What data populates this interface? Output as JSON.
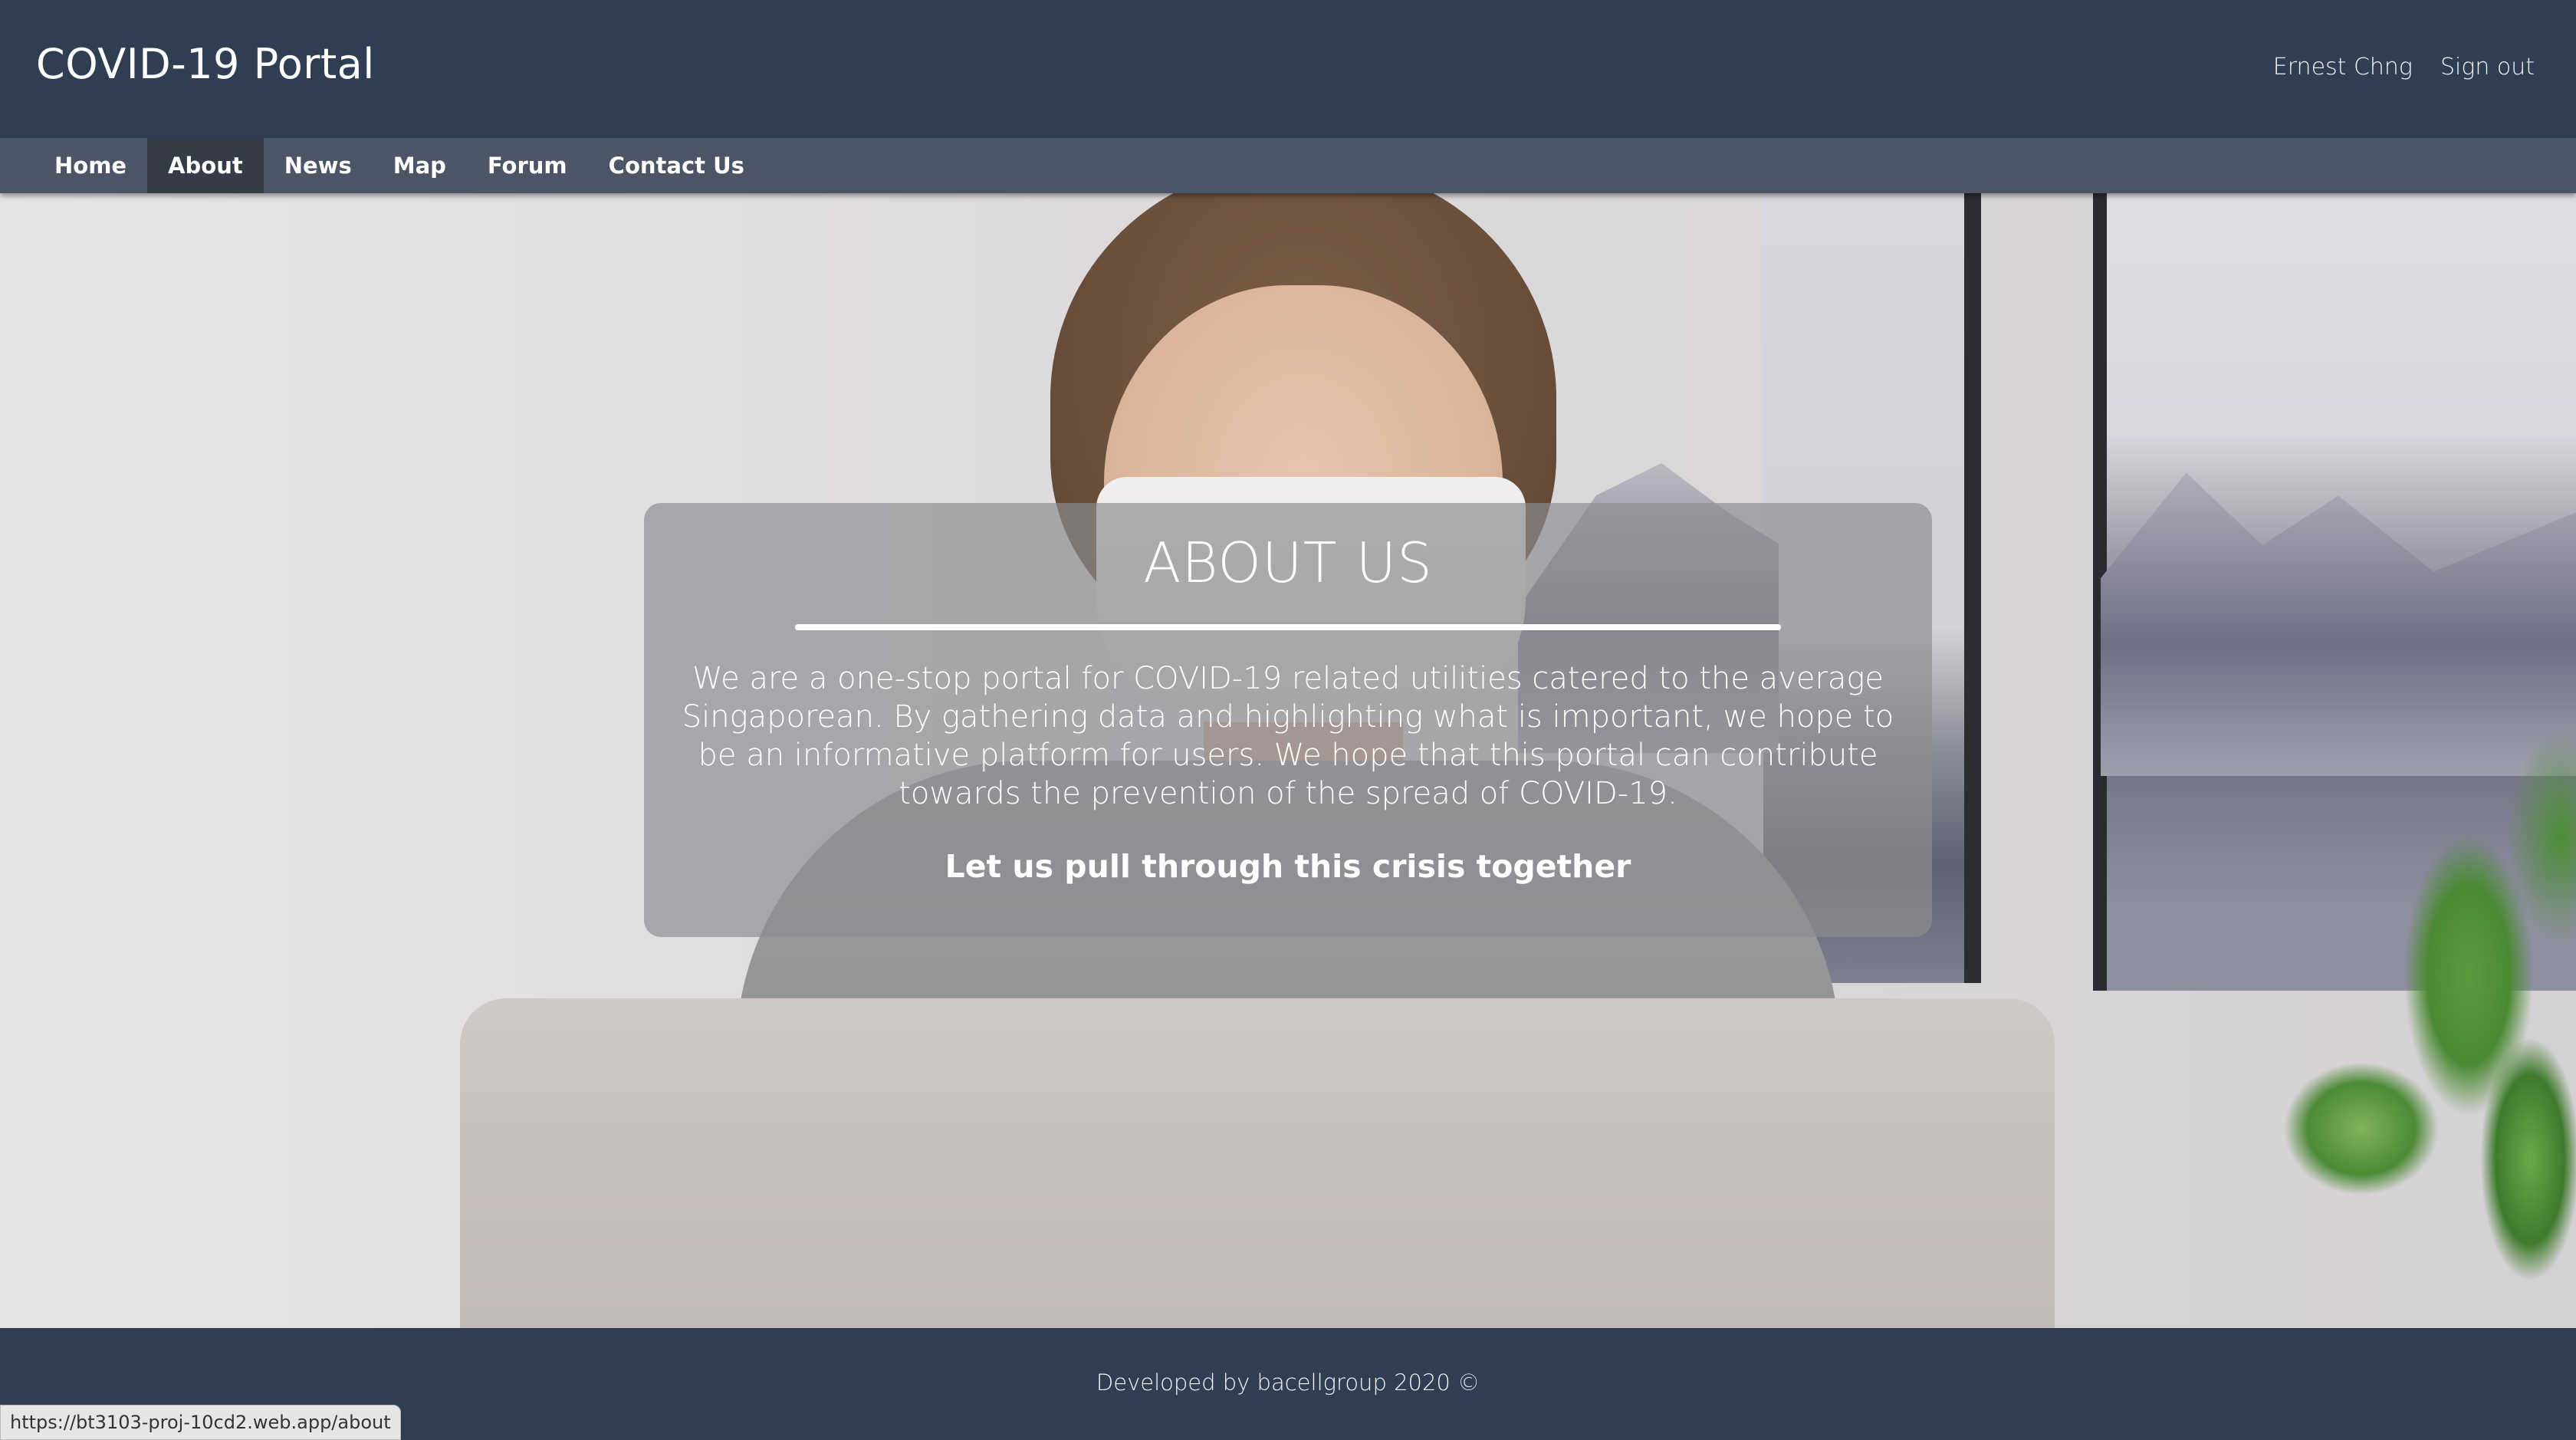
{
  "header": {
    "brand": "COVID-19 Portal",
    "user_name": "Ernest Chng",
    "sign_out": "Sign out"
  },
  "nav": {
    "items": [
      {
        "label": "Home",
        "active": false
      },
      {
        "label": "About",
        "active": true
      },
      {
        "label": "News",
        "active": false
      },
      {
        "label": "Map",
        "active": false
      },
      {
        "label": "Forum",
        "active": false
      },
      {
        "label": "Contact Us",
        "active": false
      }
    ]
  },
  "about": {
    "title": "ABOUT US",
    "body": "We are a one-stop portal for COVID-19 related utilities catered to the average Singaporean. By gathering data and highlighting what is important, we hope to be an informative platform for users. We hope that this portal can contribute towards the prevention of the spread of COVID-19.",
    "tagline": "Let us pull through this crisis together"
  },
  "footer": {
    "text": "Developed by bacellgroup 2020 ©"
  },
  "status_bar": {
    "url": "https://bt3103-proj-10cd2.web.app/about"
  },
  "colors": {
    "header_bg": "#2f3e53",
    "nav_bg": "#4b5565",
    "nav_active_bg": "#343c48"
  }
}
